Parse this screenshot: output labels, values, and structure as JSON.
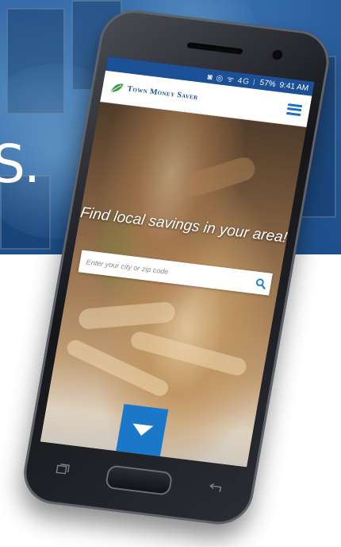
{
  "background": {
    "large_text": "S."
  },
  "statusbar": {
    "icons": "◙ ◎ ᯤ 4G ⁞",
    "battery": "57%",
    "time": "9:41 AM"
  },
  "header": {
    "logo_text": "Town Money Saver",
    "logo_icon": "leaf-icon",
    "menu_icon": "hamburger-menu-icon"
  },
  "hero": {
    "headline": "Find local savings in your area!",
    "search": {
      "placeholder": "Enter your city or zip code",
      "value": ""
    },
    "scroll_button_icon": "chevron-down-icon"
  },
  "colors": {
    "brand_blue": "#1b4f96",
    "accent_blue": "#1b78c8",
    "white": "#ffffff"
  }
}
